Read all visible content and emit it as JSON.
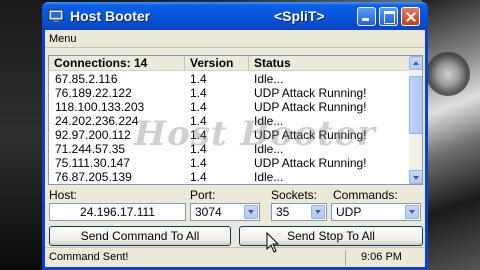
{
  "window": {
    "title": "Host Booter",
    "tag": "<SpliT>"
  },
  "menu": {
    "items": [
      "Menu"
    ]
  },
  "list": {
    "columns": [
      "Connections: 14",
      "Version",
      "Status"
    ],
    "rows": [
      {
        "ip": "67.85.2.116",
        "version": "1.4",
        "status": "Idle..."
      },
      {
        "ip": "76.189.22.122",
        "version": "1.4",
        "status": "UDP Attack Running!"
      },
      {
        "ip": "118.100.133.203",
        "version": "1.4",
        "status": "UDP Attack Running!"
      },
      {
        "ip": "24.202.236.224",
        "version": "1.4",
        "status": "Idle..."
      },
      {
        "ip": "92.97.200.112",
        "version": "1.4",
        "status": "UDP Attack Running!"
      },
      {
        "ip": "71.244.57.35",
        "version": "1.4",
        "status": "Idle..."
      },
      {
        "ip": "75.111.30.147",
        "version": "1.4",
        "status": "UDP Attack Running!"
      },
      {
        "ip": "76.87.205.139",
        "version": "1.4",
        "status": "Idle..."
      }
    ],
    "watermark": "Host Booter"
  },
  "form": {
    "host_label": "Host:",
    "host_value": "24.196.17.111",
    "port_label": "Port:",
    "port_value": "3074",
    "sockets_label": "Sockets:",
    "sockets_value": "35",
    "commands_label": "Commands:",
    "commands_value": "UDP"
  },
  "buttons": {
    "send_command": "Send Command To All",
    "send_stop": "Send Stop To All"
  },
  "status": {
    "text": "Command Sent!",
    "time": "9:06 PM"
  }
}
